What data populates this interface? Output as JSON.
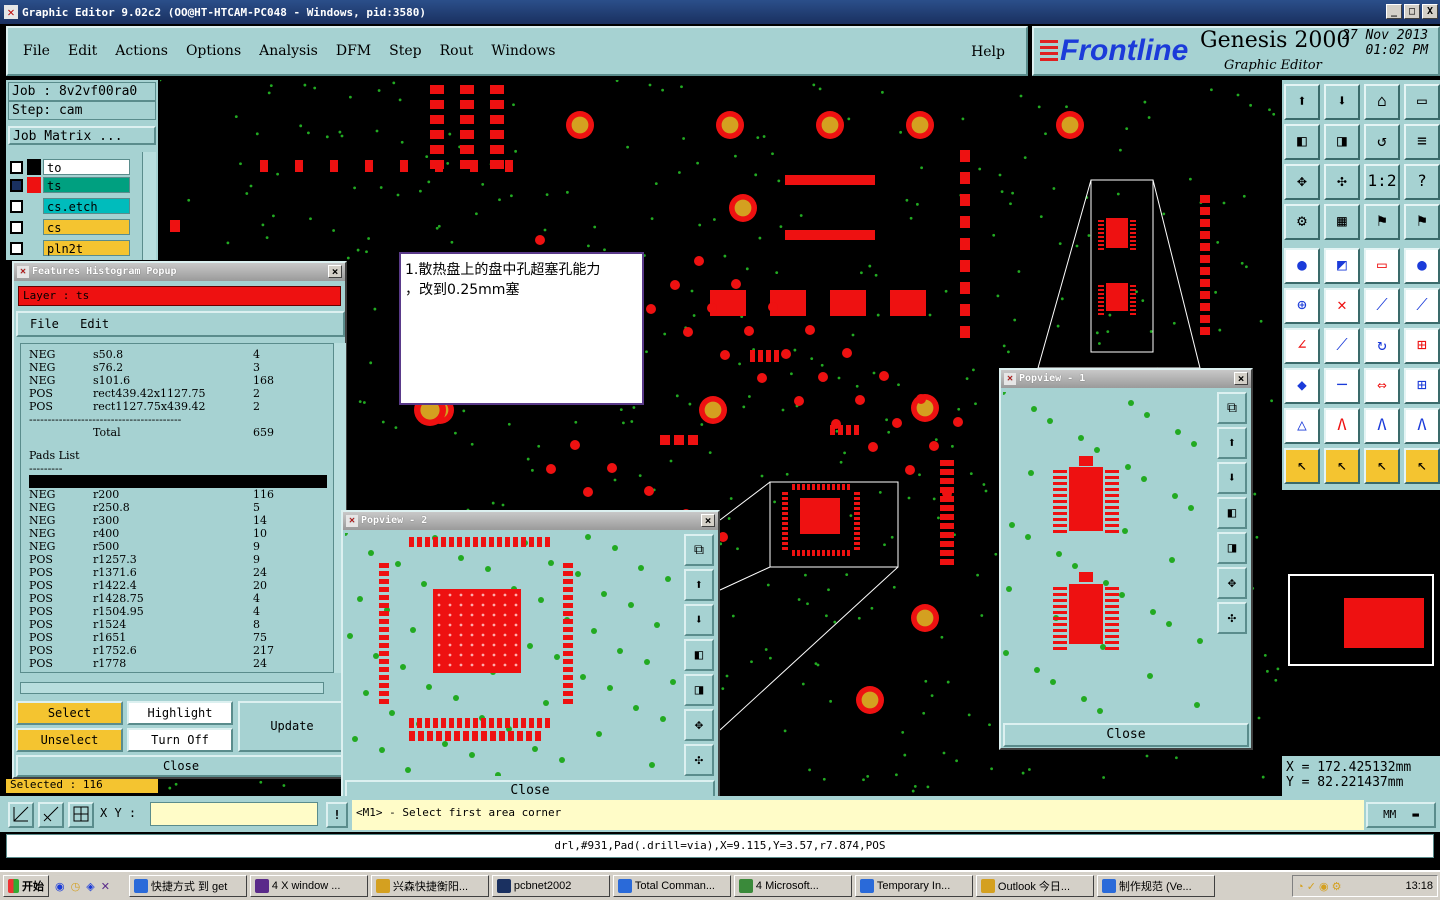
{
  "window": {
    "title": "Graphic Editor 9.02c2  (OO@HT-HTCAM-PC048 - Windows, pid:3580)",
    "controls": [
      "_",
      "□",
      "X"
    ]
  },
  "menu": {
    "items": [
      "File",
      "Edit",
      "Actions",
      "Options",
      "Analysis",
      "DFM",
      "Step",
      "Rout",
      "Windows"
    ],
    "help": "Help"
  },
  "brand": {
    "logo": "Frontline",
    "product": "Genesis 2000",
    "subtitle": "Graphic Editor",
    "date_line1": "27 Nov 2013",
    "date_line2": "01:02 PM"
  },
  "left": {
    "job": "Job : 8v2vf00ra0",
    "step": "Step: cam",
    "job_matrix": "Job Matrix ...",
    "layers": [
      {
        "name": "to",
        "color": "#ffffff"
      },
      {
        "name": "ts",
        "color": "#00a080"
      },
      {
        "name": "cs.etch",
        "color": "#00bcbc"
      },
      {
        "name": "cs",
        "color": "#f4c430"
      },
      {
        "name": "pln2t",
        "color": "#f4c430"
      }
    ]
  },
  "histogram": {
    "title": "Features Histogram Popup",
    "layer": "Layer :  ts",
    "menu": [
      "File",
      "Edit"
    ],
    "symbols": [
      [
        "NEG",
        "s50.8",
        "4"
      ],
      [
        "NEG",
        "s76.2",
        "3"
      ],
      [
        "NEG",
        "s101.6",
        "168"
      ],
      [
        "POS",
        "rect439.42x1127.75",
        "2"
      ],
      [
        "POS",
        "rect1127.75x439.42",
        "2"
      ]
    ],
    "divider": "-----------------------------------------",
    "total_label": "Total",
    "total": "659",
    "pads_header": "Pads List",
    "pads_under": "---------",
    "pads": [
      [
        "NEG",
        "r200",
        "116"
      ],
      [
        "NEG",
        "r250.8",
        "5"
      ],
      [
        "NEG",
        "r300",
        "14"
      ],
      [
        "NEG",
        "r400",
        "10"
      ],
      [
        "NEG",
        "r500",
        "9"
      ],
      [
        "POS",
        "r1257.3",
        "9"
      ],
      [
        "POS",
        "r1371.6",
        "24"
      ],
      [
        "POS",
        "r1422.4",
        "20"
      ],
      [
        "POS",
        "r1428.75",
        "4"
      ],
      [
        "POS",
        "r1504.95",
        "4"
      ],
      [
        "POS",
        "r1524",
        "8"
      ],
      [
        "POS",
        "r1651",
        "75"
      ],
      [
        "POS",
        "r1752.6",
        "217"
      ],
      [
        "POS",
        "r1778",
        "24"
      ]
    ],
    "buttons": {
      "select": "Select",
      "highlight": "Highlight",
      "update": "Update",
      "unselect": "Unselect",
      "turnoff": "Turn Off",
      "close": "Close"
    },
    "selected": "Selected : 116"
  },
  "note": {
    "line1": "1.散热盘上的盘中孔超塞孔能力",
    "line2": "，改到0.25mm塞"
  },
  "popview1": {
    "title": "Popview - 1",
    "close": "Close"
  },
  "popview2": {
    "title": "Popview - 2",
    "close": "Close"
  },
  "coords": {
    "x": "X  =  172.425132mm",
    "y": "Y  =  82.221437mm"
  },
  "status": {
    "xy_label": "X Y :",
    "prompt": "<M1> - Select first area corner",
    "units": "MM",
    "message": "drl,#931,Pad(.drill=via),X=9.115,Y=3.57,r7.874,POS"
  },
  "taskbar": {
    "start": "开始",
    "tasks": [
      "快捷方式 到 get",
      "4 X window ...",
      "兴森快捷衡阳...",
      "pcbnet2002",
      "Total Comman...",
      "4 Microsoft...",
      "Temporary In...",
      "Outlook 今日...",
      "制作规范 (Ve..."
    ],
    "clock": "13:18"
  },
  "colors": {
    "pad": "#ee1111",
    "copper": "#d4a020",
    "via": "#22aa22",
    "panel": "#a6d2d2"
  }
}
